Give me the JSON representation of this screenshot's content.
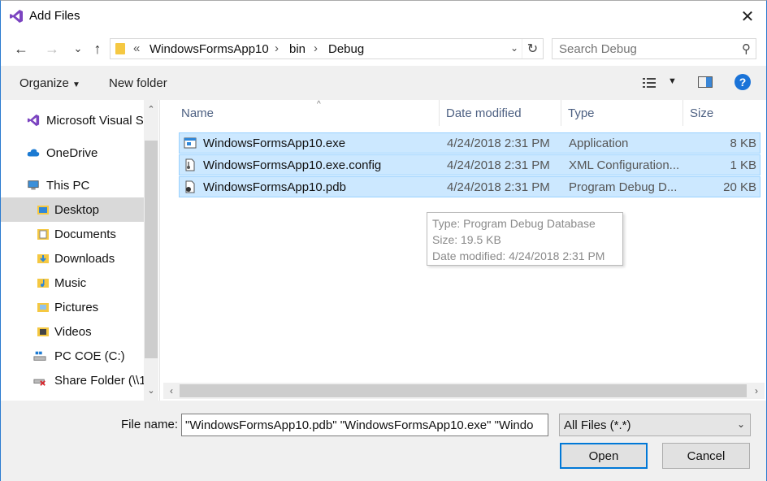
{
  "window": {
    "title": "Add Files",
    "close_glyph": "✕"
  },
  "nav": {
    "back": "←",
    "forward": "→",
    "recent": "⌄",
    "up": "↑",
    "breadcrumb": [
      "WindowsFormsApp10",
      "bin",
      "Debug"
    ],
    "overflow": "«",
    "refresh": "↻",
    "search_placeholder": "Search Debug"
  },
  "toolbar": {
    "organize": "Organize",
    "new_folder": "New folder",
    "help": "?"
  },
  "sidebar": {
    "items": [
      {
        "label": "Microsoft Visual S",
        "icon": "visual-studio-icon"
      },
      {
        "label": "OneDrive",
        "icon": "cloud-icon"
      },
      {
        "label": "This PC",
        "icon": "computer-icon"
      },
      {
        "label": "Desktop",
        "icon": "folder-icon",
        "selected": true
      },
      {
        "label": "Documents",
        "icon": "documents-icon"
      },
      {
        "label": "Downloads",
        "icon": "downloads-icon"
      },
      {
        "label": "Music",
        "icon": "music-icon"
      },
      {
        "label": "Pictures",
        "icon": "pictures-icon"
      },
      {
        "label": "Videos",
        "icon": "videos-icon"
      },
      {
        "label": "PC COE (C:)",
        "icon": "drive-icon"
      },
      {
        "label": "Share Folder (\\\\1",
        "icon": "network-drive-icon"
      }
    ]
  },
  "columns": {
    "name": "Name",
    "date": "Date modified",
    "type": "Type",
    "size": "Size"
  },
  "files": [
    {
      "name": "WindowsFormsApp10.exe",
      "date": "4/24/2018 2:31 PM",
      "type": "Application",
      "size": "8 KB",
      "icon": "exe-icon"
    },
    {
      "name": "WindowsFormsApp10.exe.config",
      "date": "4/24/2018 2:31 PM",
      "type": "XML Configuration...",
      "size": "1 KB",
      "icon": "config-icon"
    },
    {
      "name": "WindowsFormsApp10.pdb",
      "date": "4/24/2018 2:31 PM",
      "type": "Program Debug D...",
      "size": "20 KB",
      "icon": "pdb-icon"
    }
  ],
  "tooltip": {
    "type": "Type: Program Debug Database",
    "size": "Size: 19.5 KB",
    "date": "Date modified: 4/24/2018 2:31 PM"
  },
  "footer": {
    "file_name_label": "File name:",
    "file_name_value": "\"WindowsFormsApp10.pdb\" \"WindowsFormsApp10.exe\" \"Windo",
    "filter_value": "All Files (*.*)",
    "open": "Open",
    "cancel": "Cancel"
  },
  "colors": {
    "selection_bg": "#cce8ff",
    "selection_border": "#99d1ff",
    "accent": "#0078d7"
  }
}
